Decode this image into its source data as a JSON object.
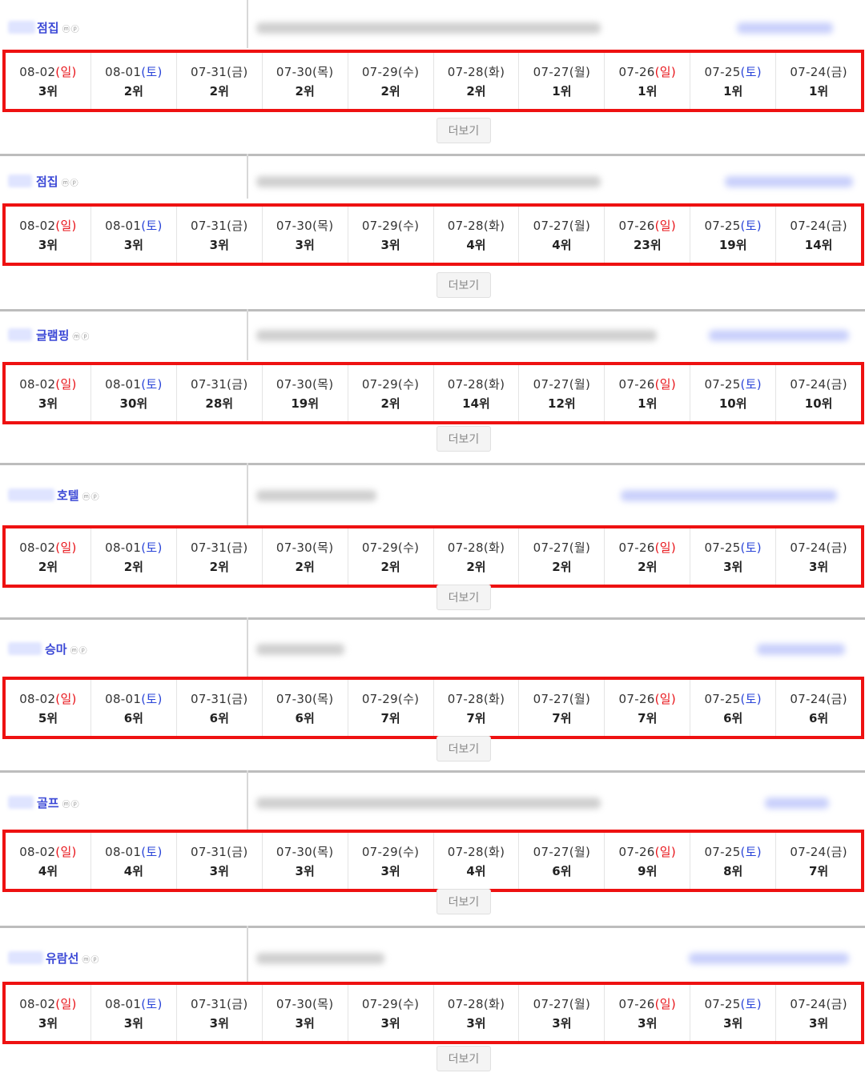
{
  "dates": [
    {
      "md": "08-02",
      "day": "일",
      "color": "red"
    },
    {
      "md": "08-01",
      "day": "토",
      "color": "blue"
    },
    {
      "md": "07-31",
      "day": "금",
      "color": ""
    },
    {
      "md": "07-30",
      "day": "목",
      "color": ""
    },
    {
      "md": "07-29",
      "day": "수",
      "color": ""
    },
    {
      "md": "07-28",
      "day": "화",
      "color": ""
    },
    {
      "md": "07-27",
      "day": "월",
      "color": ""
    },
    {
      "md": "07-26",
      "day": "일",
      "color": "red"
    },
    {
      "md": "07-25",
      "day": "토",
      "color": "blue"
    },
    {
      "md": "07-24",
      "day": "금",
      "color": ""
    }
  ],
  "more_label": "더보기",
  "mp_label": "ⓜⓟ",
  "keywords": [
    {
      "name": "점집",
      "ranks": [
        "3위",
        "2위",
        "2위",
        "2위",
        "2위",
        "2위",
        "1위",
        "1위",
        "1위",
        "1위"
      ]
    },
    {
      "name": "점집",
      "ranks": [
        "3위",
        "3위",
        "3위",
        "3위",
        "3위",
        "4위",
        "4위",
        "23위",
        "19위",
        "14위"
      ]
    },
    {
      "name": "글램핑",
      "ranks": [
        "3위",
        "30위",
        "28위",
        "19위",
        "2위",
        "14위",
        "12위",
        "1위",
        "10위",
        "10위"
      ]
    },
    {
      "name": "호텔",
      "ranks": [
        "2위",
        "2위",
        "2위",
        "2위",
        "2위",
        "2위",
        "2위",
        "2위",
        "3위",
        "3위"
      ]
    },
    {
      "name": "승마",
      "ranks": [
        "5위",
        "6위",
        "6위",
        "6위",
        "7위",
        "7위",
        "7위",
        "7위",
        "6위",
        "6위"
      ]
    },
    {
      "name": "골프",
      "ranks": [
        "4위",
        "4위",
        "3위",
        "3위",
        "3위",
        "4위",
        "6위",
        "9위",
        "8위",
        "7위"
      ]
    },
    {
      "name": "유람선",
      "ranks": [
        "3위",
        "3위",
        "3위",
        "3위",
        "3위",
        "3위",
        "3위",
        "3위",
        "3위",
        "3위"
      ]
    }
  ]
}
